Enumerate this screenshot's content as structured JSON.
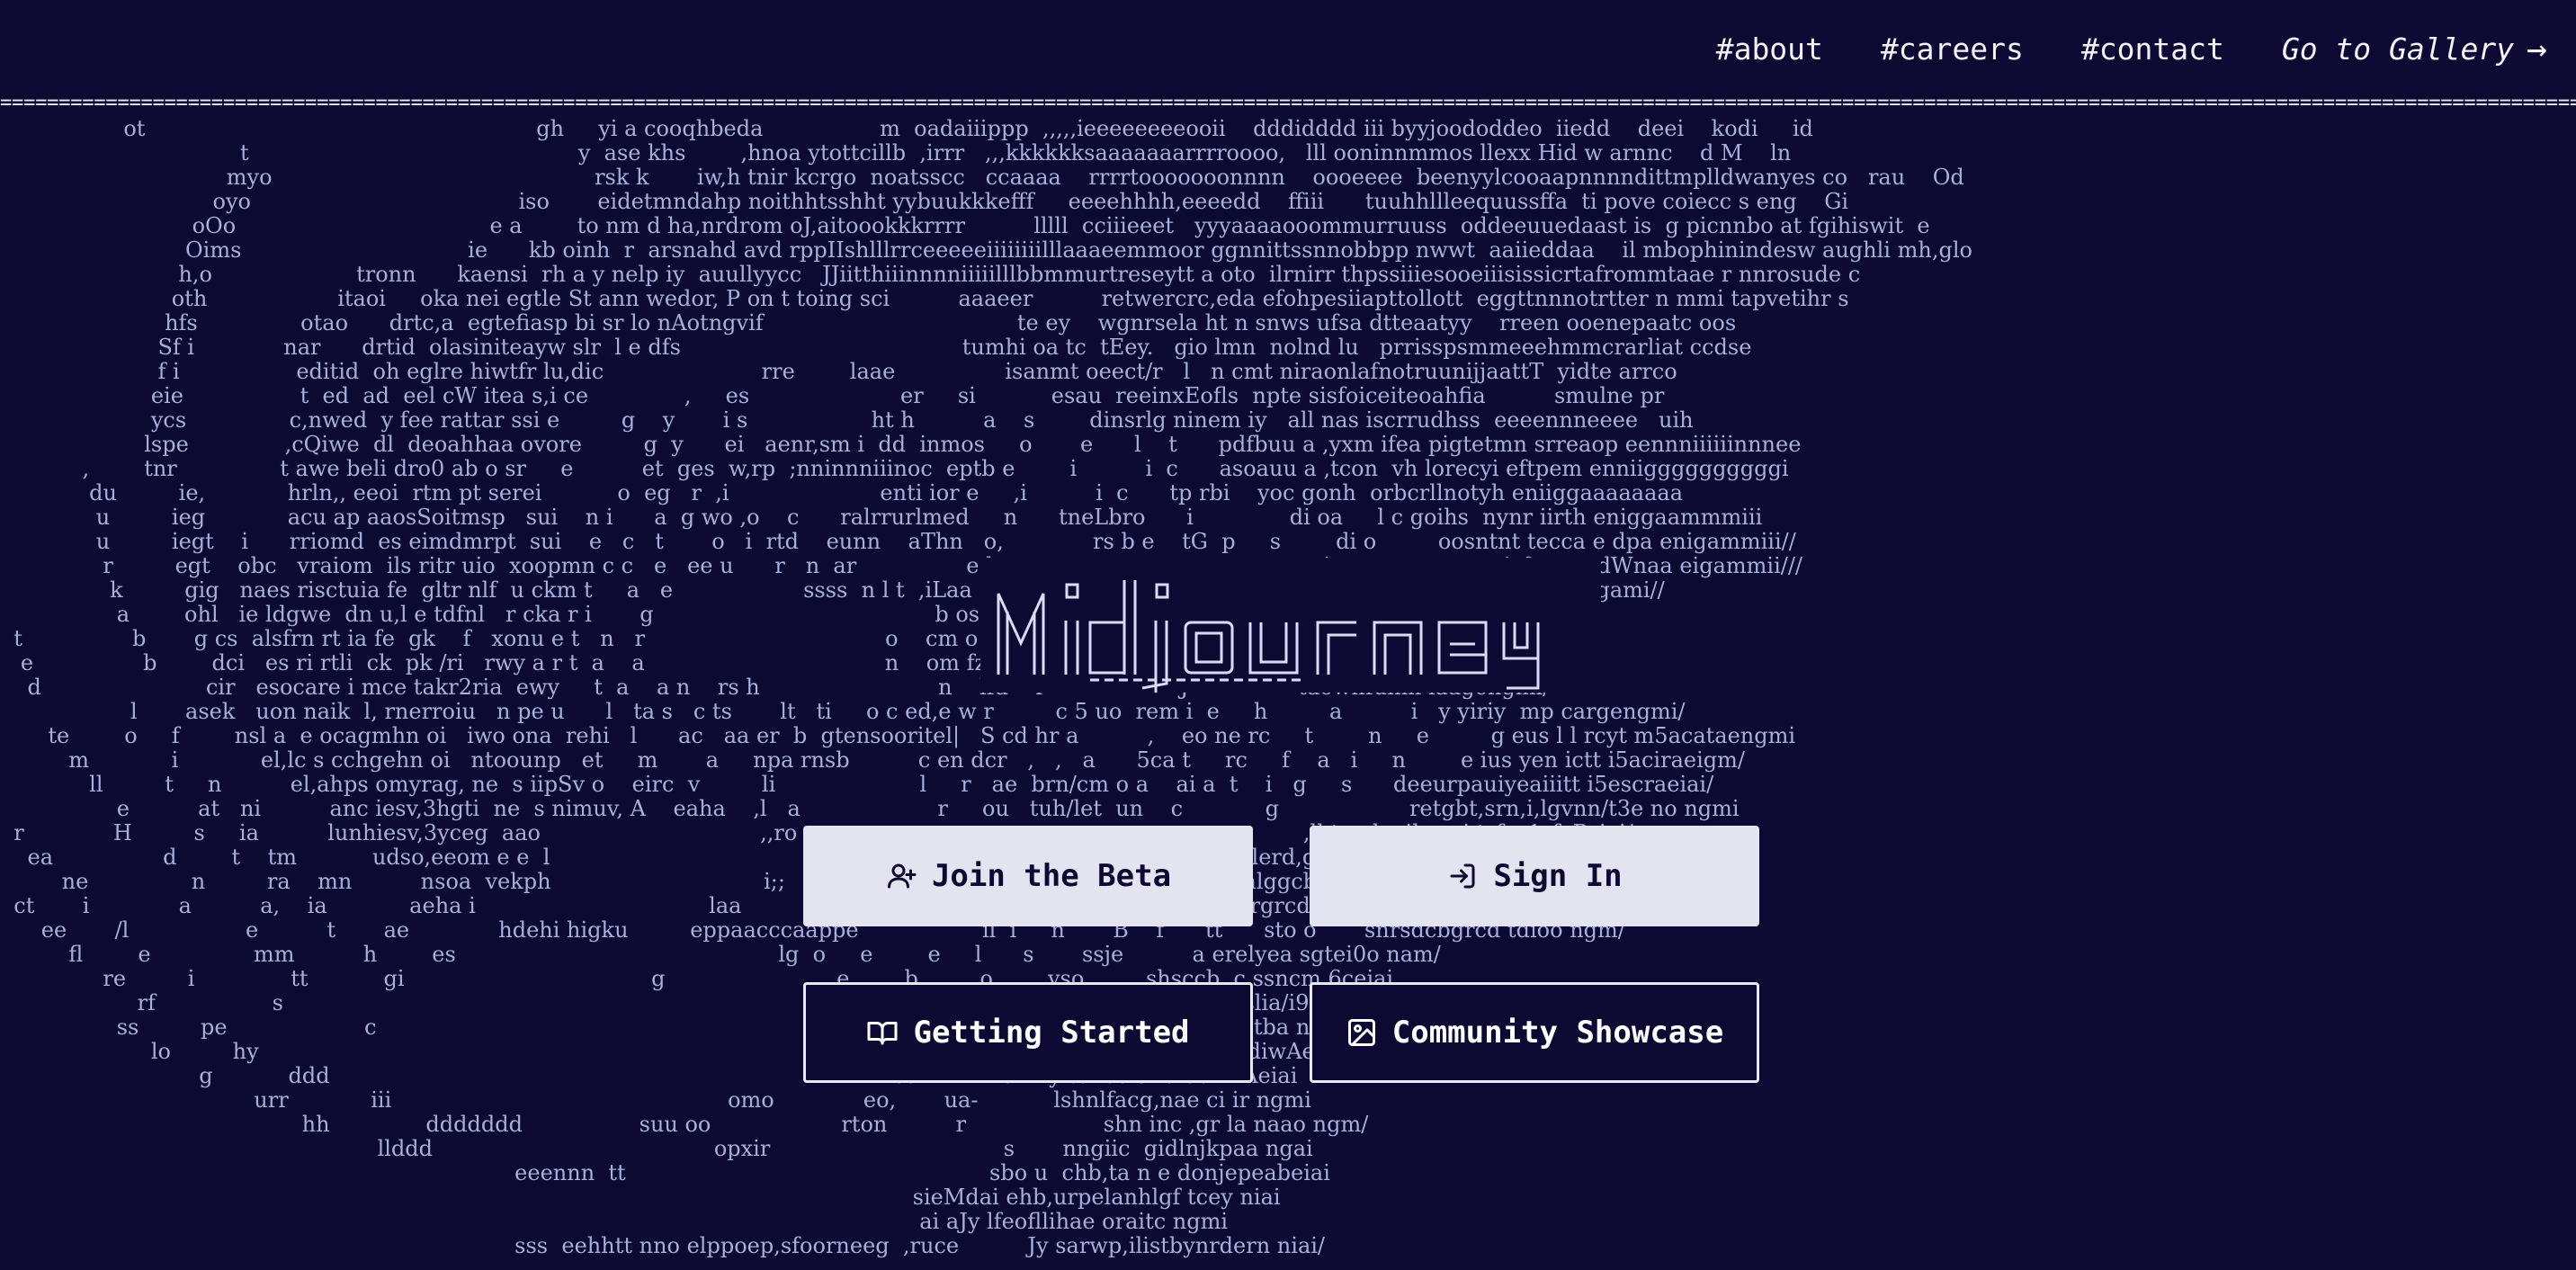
{
  "nav": {
    "links": [
      "#about",
      "#careers",
      "#contact"
    ],
    "gallery_label": "Go to Gallery",
    "gallery_arrow": "→"
  },
  "separator": "==============================================================================================================================================================================================================================================================",
  "logo": {
    "text": "Midjourney"
  },
  "buttons": {
    "join_beta": "Join the Beta",
    "sign_in": "Sign In",
    "getting_started": "Getting Started",
    "community_showcase": "Community Showcase"
  },
  "ascii_art": "                  ot                                                         gh     yi a cooqhbeda                 m  oadaiiippp  ,,,,,ieeeeeeeeooii    dddidddd iii byyjoododdeo  iiedd    deei    kodi     id\n                                   t                                                y  ase khs        ,hnoa ytottcillb  ,irrr   ,,,kkkkkksaaaaaaarrrroooo,   lll ooninnmmos llexx Hid w arnnc    d M    ln\n                                 myo                                               rsk k       iw,h tnir kcrgo  noatsscc   ccaaaa    rrrrtooooooonnnn    oooeeee  beenyylcooaapnnnndittmplldwanyes co   rau    Od\n                               oyo                                       iso       eidetmndahp noithhtsshht yybuukkkefff     eeeehhhh,eeeedd    ffiii      tuuhhllleequussffa  ti pove coiecc s eng    Gi\n                            oOo                                     e a        to nm d ha,nrdrom oJ,aitoookkkrrrr          lllll  cciiieeet   yyyaaaaooommurruuss  oddeeuuedaast is  g picnnbo at fgihiswit  e\n                           Oims                                 ie      kb oinh  r  arsnahd avd rppIIshlllrrceeeeeiiiiiiiilllaaaeemmoor ggnnittssnnobbpp nwwt  aaiieddaa    il mbophinindesw aughli mh,glo\n                          h,o                     tronn      kaensi  rh a y nelp iy  auullyycc   JJiitthiiinnnniiiiilllbbmmurtreseytt a oto  ilrnirr thpssiiiesooeiiisissicrtafrommtaae r nnrosude c\n                         oth                   itaoi     oka nei egtle St ann wedor, P on t toing sci          aaaeer          retwercrc,eda efohpesiiapttollott  eggttnnnotrtter n mmi tapvetihr s\n                        hfs               otao      drtc,a  egtefiasp bi sr lo nAotngvif                                     te ey    wgnrsela ht n snws ufsa dtteaatyy    rreen ooenepaatc oos\n                       Sf i             nar      drtid  olasiniteayw slr  l e dfs                                         tumhi oa tc  tEey.   gio lmn  nolnd lu   prrisspsmmeeehmmcrarliat ccdse\n                       f i                 editid  oh eglre hiwtfr lu,dic                       rre        laae                isanmt oeect/r   l   n cmt niraonlafnotruunijjaattT  yidte arrco\n                      eie                 t  ed  ad  eel cW itea s,i ce              ,     es                      er     si           esau  reeinxEofls  npte sisfoiceiteoahfia          smulne pr\n                      ycs               c,nwed  y fee rattar ssi e         g    y       i s                  ht h          a    s        dinsrlg ninem iy   all nas iscrrudhss  eeeennneeee   uih\n                     lspe              ,cQiwe  dl  deoahhaa ovore         g  y      ei   aenr,sm i  dd  inmos     o       e      l    t      pdfbuu a ,yxm ifea pigtetmn srreaop eennniiiiiinnnee\n            ,        tnr               t awe beli dro0 ab o sr     e          et  ges  w,rp  ;nninnniiinoc  eptb e        i          i  c      asoauu a ,tcon  vh lorecyi eftpem enniiggggggggggi\n             du         ie,            hrln,, eeoi  rtm pt serei           o  eg   r  ,i                      enti ior e     ,i          i  c      tp rbi    yoc gonh  orbcrllnotyh eniiggaaaaaaaa\n              u         ieg            acu ap aaosSoitmsp   sui    n i      a  g wo ,o    c      ralrrurlmed     n      tneLbro      i              di oa     l c goihs  nynr iirth eniggaammmiii\n              u         iegt    i      rriomd  es eimdmrpt  sui    e   c   t       o   i  rtd    eunn    aThn   o,             rs b e    tG  p     s        di o         oosntnt tecca e dpa enigammiii//\n               r         egt    obc   vraiom  ils ritr uio  xoopmn c c   e   ee u      r   n  ar                e h  wne          eetm  v  e             i     e           o stsis0eesacdWnaa eigammii///\n                k         gig   naes risctuia fe  gltr nlf  u ckm t     a   e                   ssss  n l t  ,iLaa          a oz    n       p       g                 Rersnesresaftrnaa nigami//\n                 a        ohl   ie ldgwe  dn u,l e tdfnl   r cka r i       g                                         b oss gn  G  -        h                       erire0.dsyfs iosengami/\n  t                b       g cs  alsfrn rt ia fe  gk    f   xonu e t   n   r                                   o    cm o c era i l        h     J                   srsabh.dnoos no niami/\n   e                b        dci   es ri rtli  ck  pk /ri   rwy a r t  a    a                                   n    om fzs gfd G -                               l iz te ug iniReigmi/\n    d                        cir   esocare i mce takr2ria  ewy     t  a    a n    rs h                          n    lfd    l                    J                taowhfunm iaagengmi/\n                   l       asek   uon naik  l, rnerroiu   n pe u      l   ta s   c ts       lt   ti     o c ed,e w r         c 5 uo  rem i  e     h         a          i   y yiriy  mp cargengmi/\n       te        o     f        nsl a  e ocagmhn oi   iwo ona  rehi   l      ac   aa er  b  gtensooritel|   S cd hr a          ,    eo ne rc     t        n     e         g eus l l rcyt m5acataengmi\n          m            i            el,lc s cchgehn oi   ntoounp   et     m       a     npa rnsb          c en dcr   ,   ,   a      5ca t     rc     f    a   i     n        e ius yen ictt i5aciraeigm/\n             ll         t     n          el,ahps omyrag, ne  s iipSv o    eirc  v         li                     l     r   ae  brn/cm o a    ai a  t    i   g     s      deeurpauiyeaiiitt i5escraeiai/\n                 e          at   ni          anc iesv,3hgti  ne  s nimuv, A    eaha    ,l   a                    r     ou   tuh/let  un    c            g                   retgbt,srn,i,lgvnn/t3e no ngmi\n  r             H         s     ia          lunhiesv,3yceg  aao                                ,,ro                                   m  c                                ,lhtncdyuiheasi trfnr1rfaPeiai/\n    ea                d        t    tm           udso,eeom e e  l                                                                   o    ,         t     t lotf,ec lerd,ggnaigtted r ngm/\n         ne               n         ra    mn          nsoa  vekph                               i;;                               ,   r     r     t, otf,ec liruhlggcb ituooa ngm/\n  ct       i             a          a,    ia            aeha i                                  laa                            B   r      t       imc,pincdy,li,uhrgrcd  tuioa ngm/\n      ee       /l                 e          t       ae             hdehi higku         eppaacccaappe                  il  i     n       B    f      tt      sto o       snrsdcbgrcd tdioo ngm/\n          fl        e               mm          h        es                                               lg  o     e        e     l      s       ssje          a erelyea sgtei0o nam/\n               re         i              tt           gi                                    g                         e        b         o        vso         shsccb  c ssncm 6ceiai\n                    rf                 s                                                                                                       p a      ao   shklccabphtslia/i9 ngm/\n                 ss         pe                    c                                                                                        wp      n ed d i shk icryectba n sw1ngmi\n                      lo         hy                                                                                          vrp   ann n aoRodfetifl ctoecnbrgtdiwAeiai\n                             g           ddd                                                                                  oann n nneni  y tol eo snbratwirAeiai\n                                     urr            iii                                                 omo             eo,       ua-           lshnlfacg,nae ci ir ngmi\n                                            hh              ddddddd                 suu oo                   rton          r                    shn inc ,gr la naao ngm/\n                                                       llddd                                         opxir                                  s       nngiic  gidlnjkpaa ngai\n                                                                           eeennn  tt                                                     sbo u  chb,ta n e donjepeabeiai\n                                                                                                                                     sieMdai ehb,urpelanhlgf tcey niai\n                                                                                                                                      ai aJy lfeofllihae oraitc ngmi\n                                                                           sss  eehhtt nno elppoep,sfoorneeg  ,ruce          Jy sarwp,ilistbynrdern niai/"
}
